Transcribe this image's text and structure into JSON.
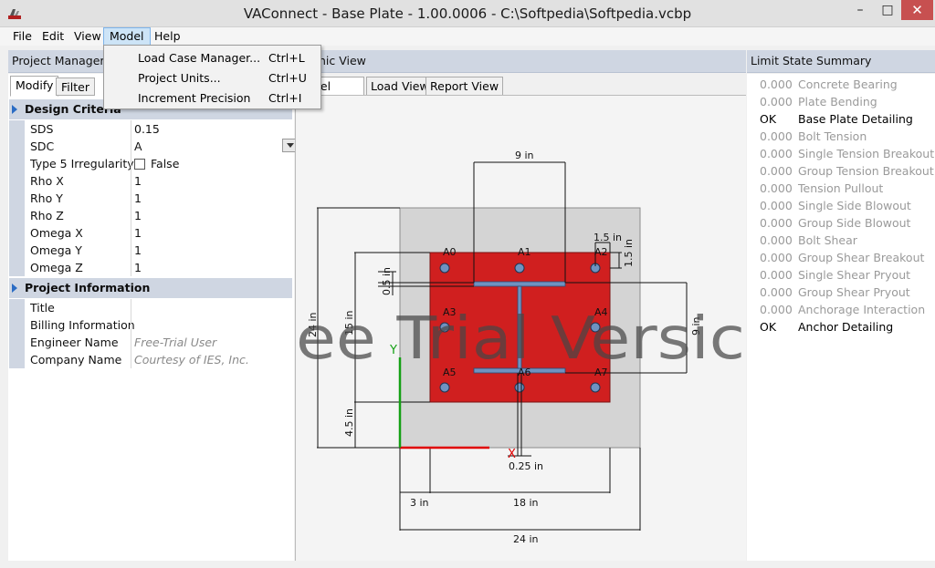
{
  "window": {
    "title": "VAConnect - Base Plate - 1.00.0006 - C:\\Softpedia\\Softpedia.vcbp",
    "minimize": "–",
    "maximize": "□",
    "close": "✕"
  },
  "menu": {
    "items": [
      "File",
      "Edit",
      "View",
      "Model",
      "Help"
    ],
    "active": "Model"
  },
  "model_menu": {
    "items": [
      {
        "label": "Load Case Manager...",
        "shortcut": "Ctrl+L"
      },
      {
        "label": "Project Units...",
        "shortcut": "Ctrl+U"
      },
      {
        "label": "Increment Precision",
        "shortcut": "Ctrl+I"
      }
    ]
  },
  "project_manager": {
    "header": "Project Manager",
    "tabs": [
      "Modify",
      "Filter"
    ],
    "sections": {
      "design_criteria": {
        "label": "Design Criteria",
        "rows": [
          {
            "name": "SDS",
            "value": "0.15"
          },
          {
            "name": "SDC",
            "value": "A"
          },
          {
            "name": "Type 5 Irregularity?",
            "value": "False"
          },
          {
            "name": "Rho X",
            "value": "1"
          },
          {
            "name": "Rho Y",
            "value": "1"
          },
          {
            "name": "Rho Z",
            "value": "1"
          },
          {
            "name": "Omega X",
            "value": "1"
          },
          {
            "name": "Omega Y",
            "value": "1"
          },
          {
            "name": "Omega Z",
            "value": "1"
          }
        ]
      },
      "project_information": {
        "label": "Project Information",
        "rows": [
          {
            "name": "Title",
            "value": ""
          },
          {
            "name": "Billing Information",
            "value": ""
          },
          {
            "name": "Engineer Name",
            "value": "Free-Trial User"
          },
          {
            "name": "Company Name",
            "value": "Courtesy of IES, Inc."
          }
        ]
      }
    }
  },
  "graphic_view": {
    "header": "Graphic View",
    "header_visible": "hic View",
    "tabs": [
      "Model View",
      "Load View",
      "Report View"
    ],
    "tab0_visible": "del View",
    "watermark": "ee Trial Versic",
    "axis_x": "X",
    "axis_y": "Y",
    "bolts": [
      "A0",
      "A1",
      "A2",
      "A3",
      "A4",
      "A5",
      "A6",
      "A7"
    ],
    "dims": {
      "top_flange": "9 in",
      "edge_h": "1.5 in",
      "edge_v": "1.5 in",
      "flange_th": "0.5 in",
      "left_total": "24 in",
      "left_plate": "15 in",
      "right_col": "9 in",
      "bottom_left": "4.5 in",
      "web": "0.25 in",
      "offset": "3 in",
      "plate_w": "18 in",
      "total_w": "24 in"
    },
    "colors": {
      "plate": "#d01f1f",
      "concrete": "#d4d4d4",
      "steel": "#6f92c0"
    }
  },
  "limit_state": {
    "header": "Limit State Summary",
    "rows": [
      {
        "value": "0.000",
        "name": "Concrete Bearing",
        "active": false
      },
      {
        "value": "0.000",
        "name": "Plate Bending",
        "active": false
      },
      {
        "value": "OK",
        "name": "Base Plate Detailing",
        "active": true
      },
      {
        "value": "0.000",
        "name": "Bolt Tension",
        "active": false
      },
      {
        "value": "0.000",
        "name": "Single Tension Breakout",
        "active": false
      },
      {
        "value": "0.000",
        "name": "Group Tension Breakout",
        "active": false
      },
      {
        "value": "0.000",
        "name": "Tension Pullout",
        "active": false
      },
      {
        "value": "0.000",
        "name": "Single Side Blowout",
        "active": false
      },
      {
        "value": "0.000",
        "name": "Group Side Blowout",
        "active": false
      },
      {
        "value": "0.000",
        "name": "Bolt Shear",
        "active": false
      },
      {
        "value": "0.000",
        "name": "Group Shear Breakout",
        "active": false
      },
      {
        "value": "0.000",
        "name": "Single Shear Pryout",
        "active": false
      },
      {
        "value": "0.000",
        "name": "Group Shear Pryout",
        "active": false
      },
      {
        "value": "0.000",
        "name": "Anchorage Interaction",
        "active": false
      },
      {
        "value": "OK",
        "name": "Anchor Detailing",
        "active": true
      }
    ]
  }
}
